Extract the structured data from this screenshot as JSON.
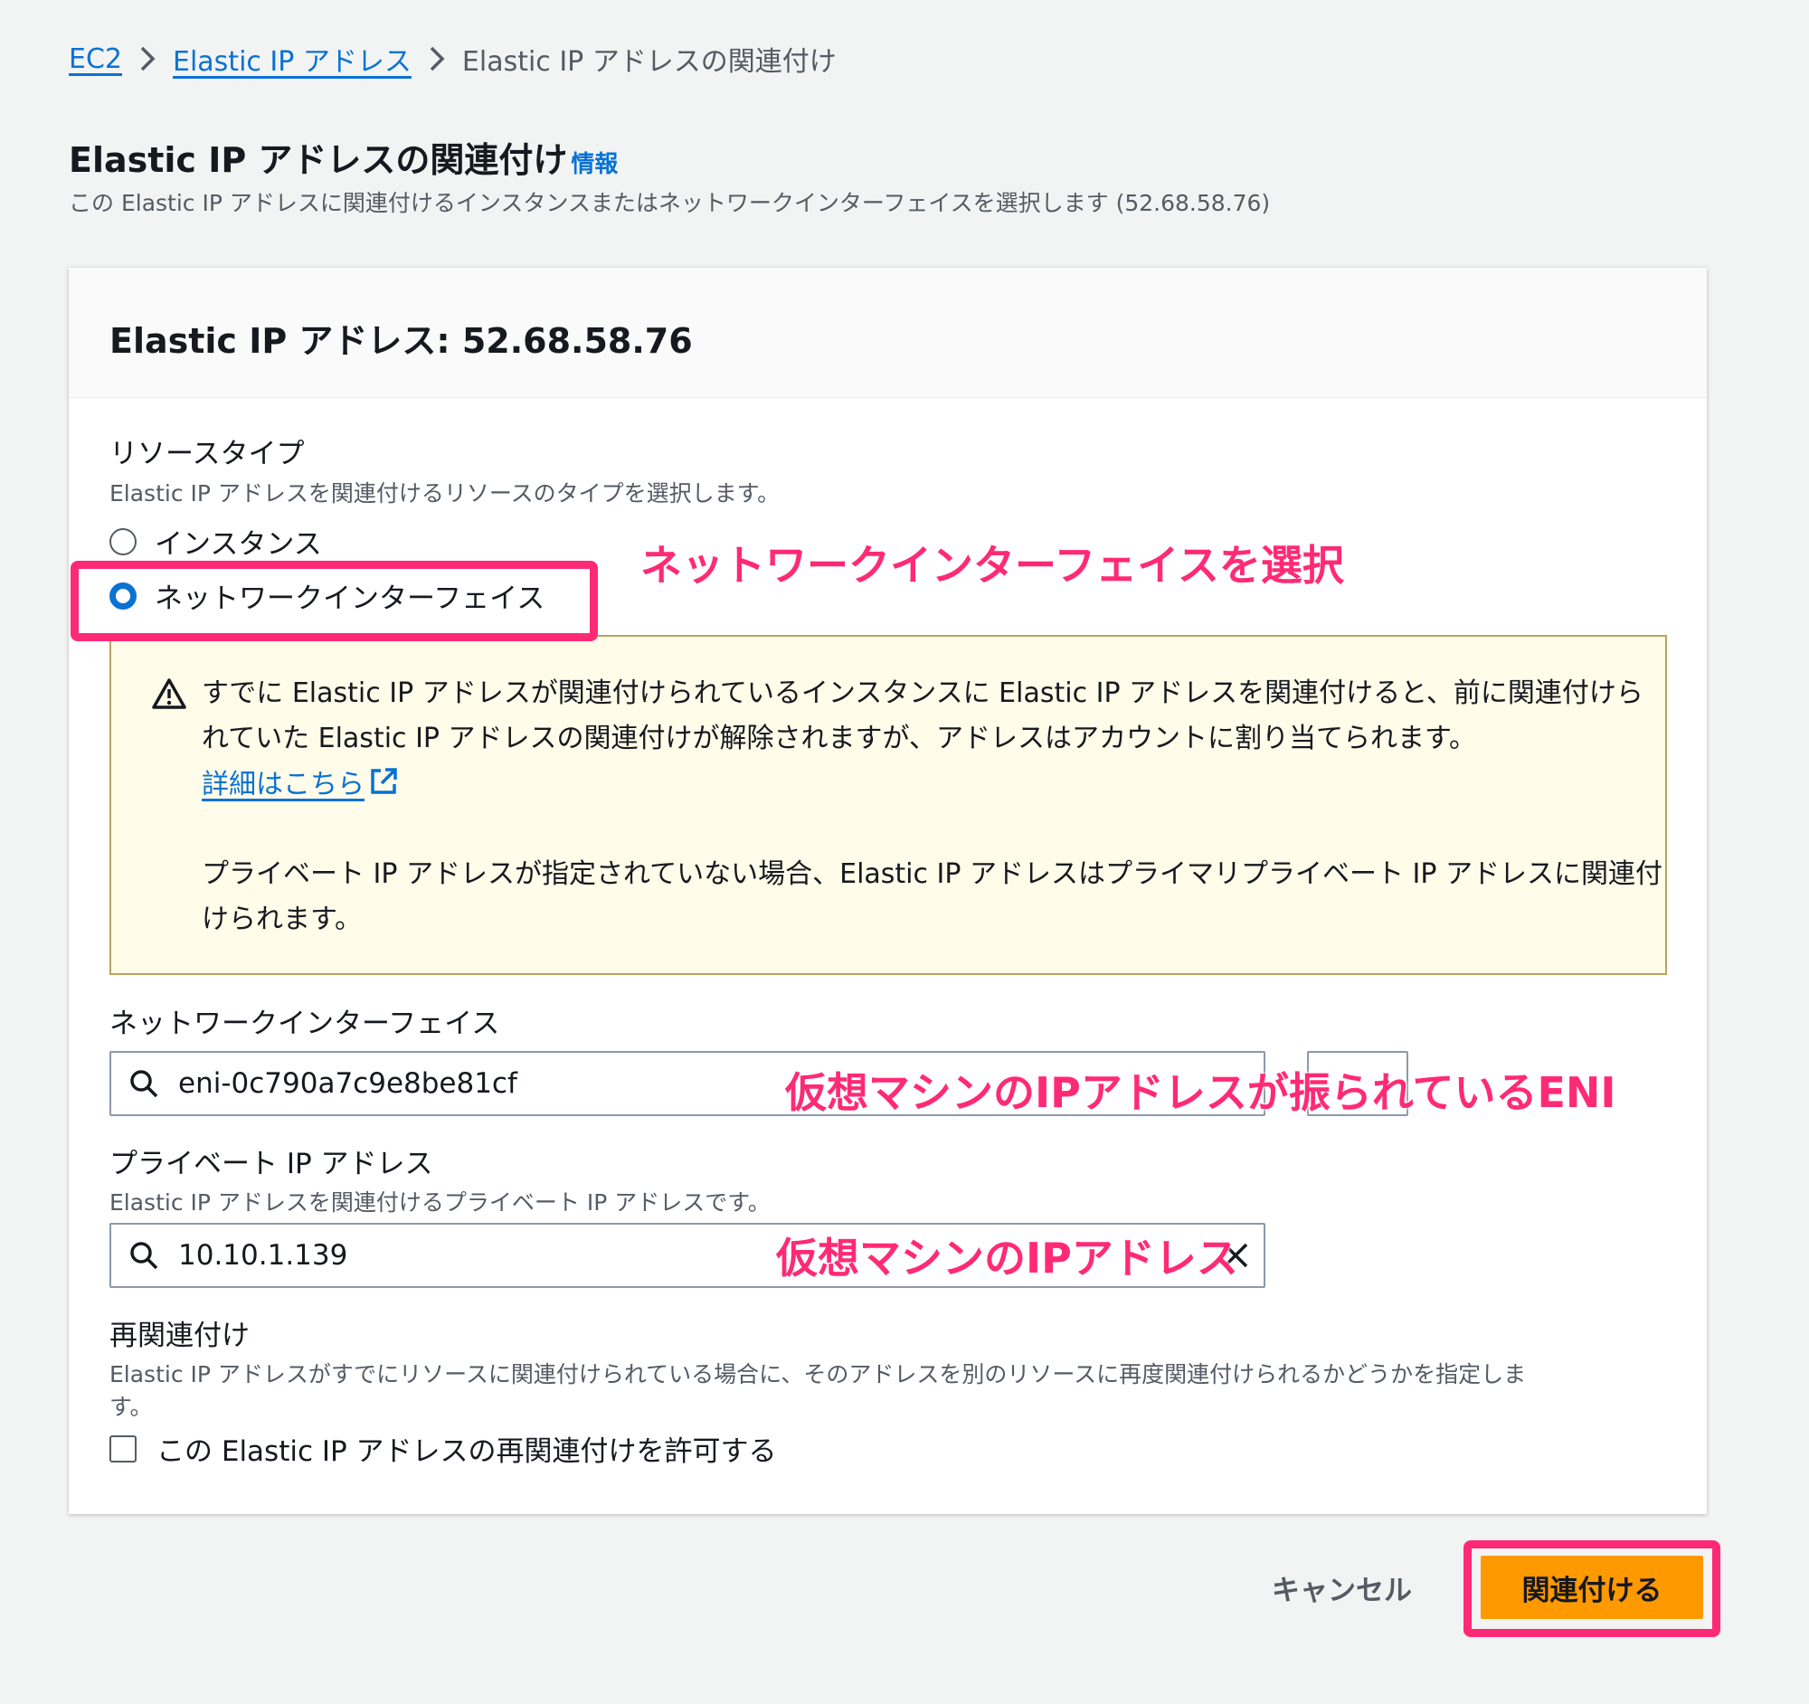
{
  "breadcrumb": {
    "items": [
      "EC2",
      "Elastic IP アドレス"
    ],
    "current": "Elastic IP アドレスの関連付け"
  },
  "page": {
    "title": "Elastic IP アドレスの関連付け",
    "info_link": "情報",
    "description": "この Elastic IP アドレスに関連付けるインスタンスまたはネットワークインターフェイスを選択します (52.68.58.76)"
  },
  "panel": {
    "title": "Elastic IP アドレス: 52.68.58.76"
  },
  "resource_type": {
    "label": "リソースタイプ",
    "description": "Elastic IP アドレスを関連付けるリソースのタイプを選択します。",
    "options": [
      "インスタンス",
      "ネットワークインターフェイス"
    ],
    "selected": "ネットワークインターフェイス"
  },
  "alert": {
    "text1": "すでに Elastic IP アドレスが関連付けられているインスタンスに Elastic IP アドレスを関連付けると、前に関連付けられていた Elastic IP アドレスの関連付けが解除されますが、アドレスはアカウントに割り当てられます。",
    "link": "詳細はこちら",
    "text2": "プライベート IP アドレスが指定されていない場合、Elastic IP アドレスはプライマリプライベート IP アドレスに関連付けられます。"
  },
  "network_interface": {
    "label": "ネットワークインターフェイス",
    "value": "eni-0c790a7c9e8be81cf"
  },
  "private_ip": {
    "label": "プライベート IP アドレス",
    "description": "Elastic IP アドレスを関連付けるプライベート IP アドレスです。",
    "value": "10.10.1.139"
  },
  "reassociation": {
    "label": "再関連付け",
    "description": "Elastic IP アドレスがすでにリソースに関連付けられている場合に、そのアドレスを別のリソースに再度関連付けられるかどうかを指定しま",
    "description_cont": "す。",
    "checkbox_label": "この Elastic IP アドレスの再関連付けを許可する"
  },
  "buttons": {
    "cancel": "キャンセル",
    "associate": "関連付ける"
  },
  "annotations": {
    "select_eni": "ネットワークインターフェイスを選択",
    "eni_note": "仮想マシンのIPアドレスが振られているENI",
    "ip_note": "仮想マシンのIPアドレス"
  },
  "colors": {
    "accent": "#0972d3",
    "primary_button": "#ff9900",
    "annotation": "#ff2a75",
    "alert_bg": "#fffce9"
  }
}
